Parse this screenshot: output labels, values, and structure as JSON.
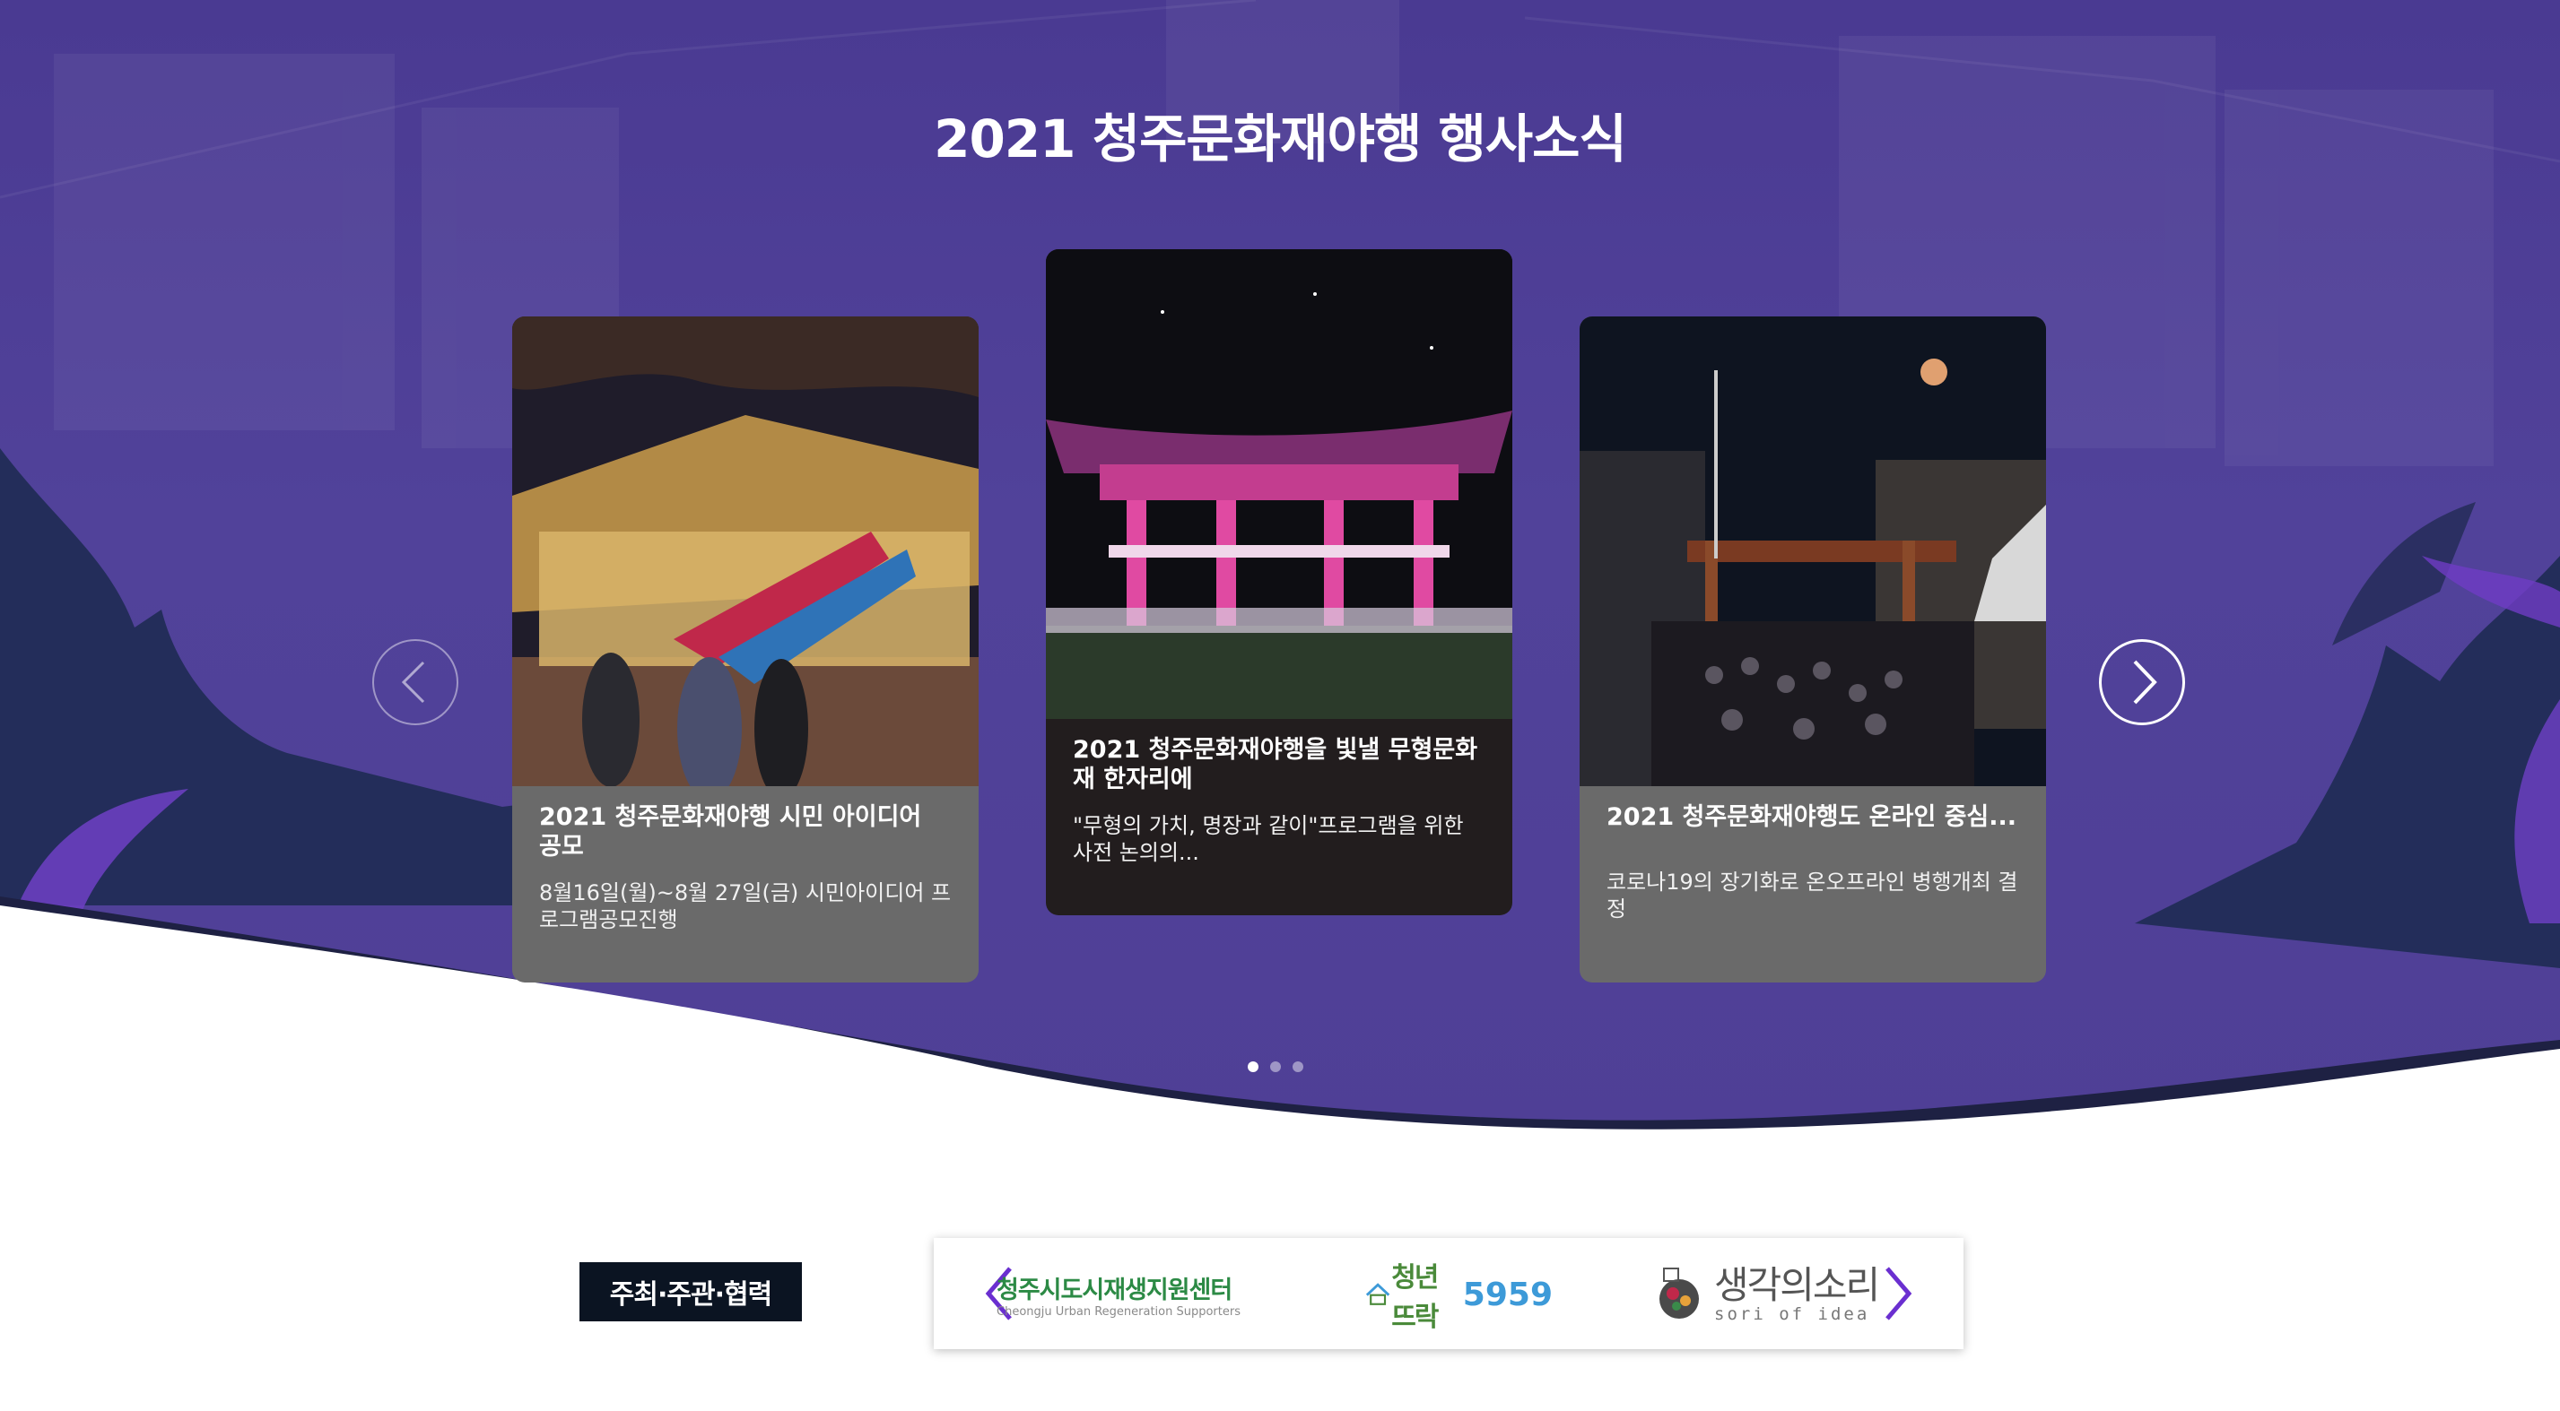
{
  "section": {
    "title_regular": "2021 청주문화재야행",
    "title_bold": "행사소식"
  },
  "cards": [
    {
      "title": "2021 청주문화재야행 시민 아이디어 공모",
      "desc": "8월16일(월)~8월 27일(금) 시민아이디어 프로그램공모진행"
    },
    {
      "title": "2021 청주문화재야행을 빛낼 무형문화재 한자리에",
      "desc": "\"무형의 가치, 명장과 같이\"프로그램을 위한 사전 논의의..."
    },
    {
      "title": "2021 청주문화재야행도 온라인 중심...",
      "desc": "코로나19의 장기화로 온오프라인 병행개최 결정"
    }
  ],
  "carousel": {
    "prev_icon": "chevron-left-icon",
    "next_icon": "chevron-right-icon",
    "page_count": 3,
    "active_index": 0
  },
  "footer": {
    "host_label": "주최·주관·협력",
    "partners": [
      {
        "name": "청주시도시재생지원센터",
        "sub": "Cheongju Urban Regeneration Supporters"
      },
      {
        "name": "청년뜨락",
        "number": "5959"
      },
      {
        "name": "생각의소리",
        "sub": "sori of idea"
      }
    ]
  },
  "colors": {
    "hero_purple": "#4f3f96",
    "dark_navy": "#232746",
    "card_grey": "#6a6a6a",
    "card_dark": "#221d1e",
    "accent_violet": "#6a2fd0"
  }
}
